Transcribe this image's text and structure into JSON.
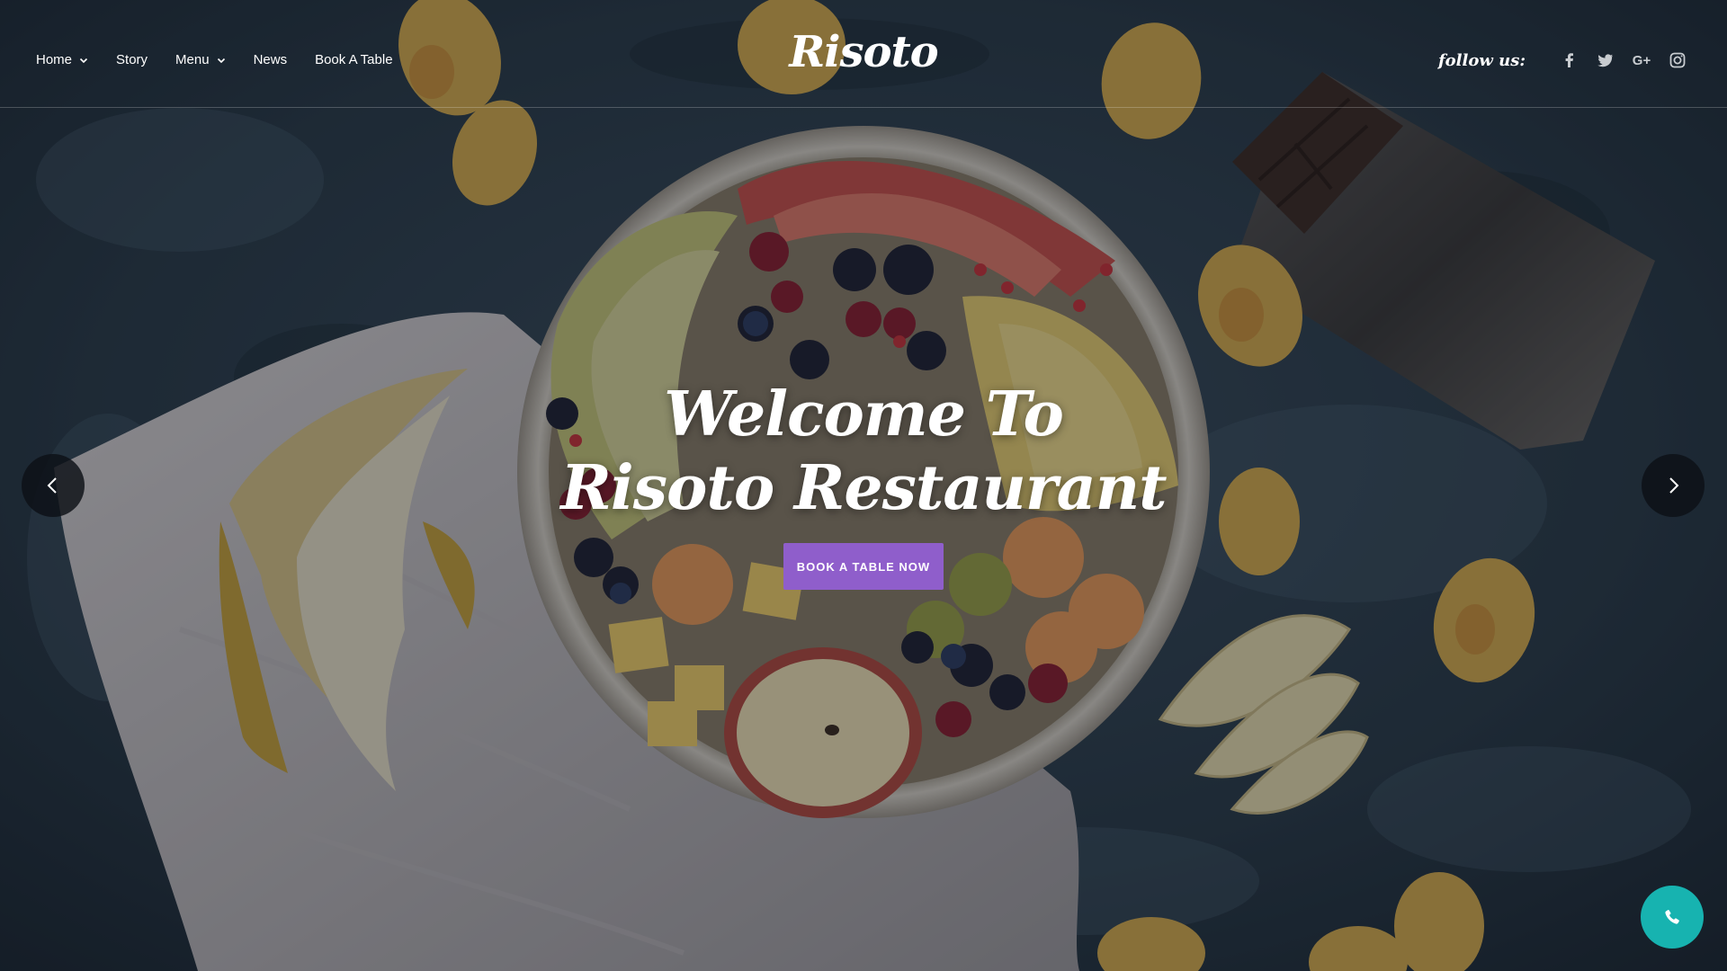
{
  "colors": {
    "accent": "#8f5ecb",
    "phone_button": "#17b3b0",
    "arrow_bg": "#0c1016",
    "text": "#ffffff"
  },
  "header": {
    "nav": [
      {
        "label": "Home",
        "has_dropdown": true
      },
      {
        "label": "Story",
        "has_dropdown": false
      },
      {
        "label": "Menu",
        "has_dropdown": true
      },
      {
        "label": "News",
        "has_dropdown": false
      },
      {
        "label": "Book A Table",
        "has_dropdown": false
      }
    ],
    "logo": "Risoto",
    "follow_label": "follow us:",
    "social": [
      {
        "icon": "facebook-icon"
      },
      {
        "icon": "twitter-icon"
      },
      {
        "icon": "google-plus-icon",
        "text": "G+"
      },
      {
        "icon": "instagram-icon"
      }
    ]
  },
  "hero": {
    "title_line1": "Welcome To",
    "title_line2": "Risoto Restaurant",
    "cta_label": "BOOK A TABLE NOW"
  },
  "controls": {
    "prev_icon": "chevron-left-icon",
    "next_icon": "chevron-right-icon",
    "phone_icon": "phone-icon"
  }
}
